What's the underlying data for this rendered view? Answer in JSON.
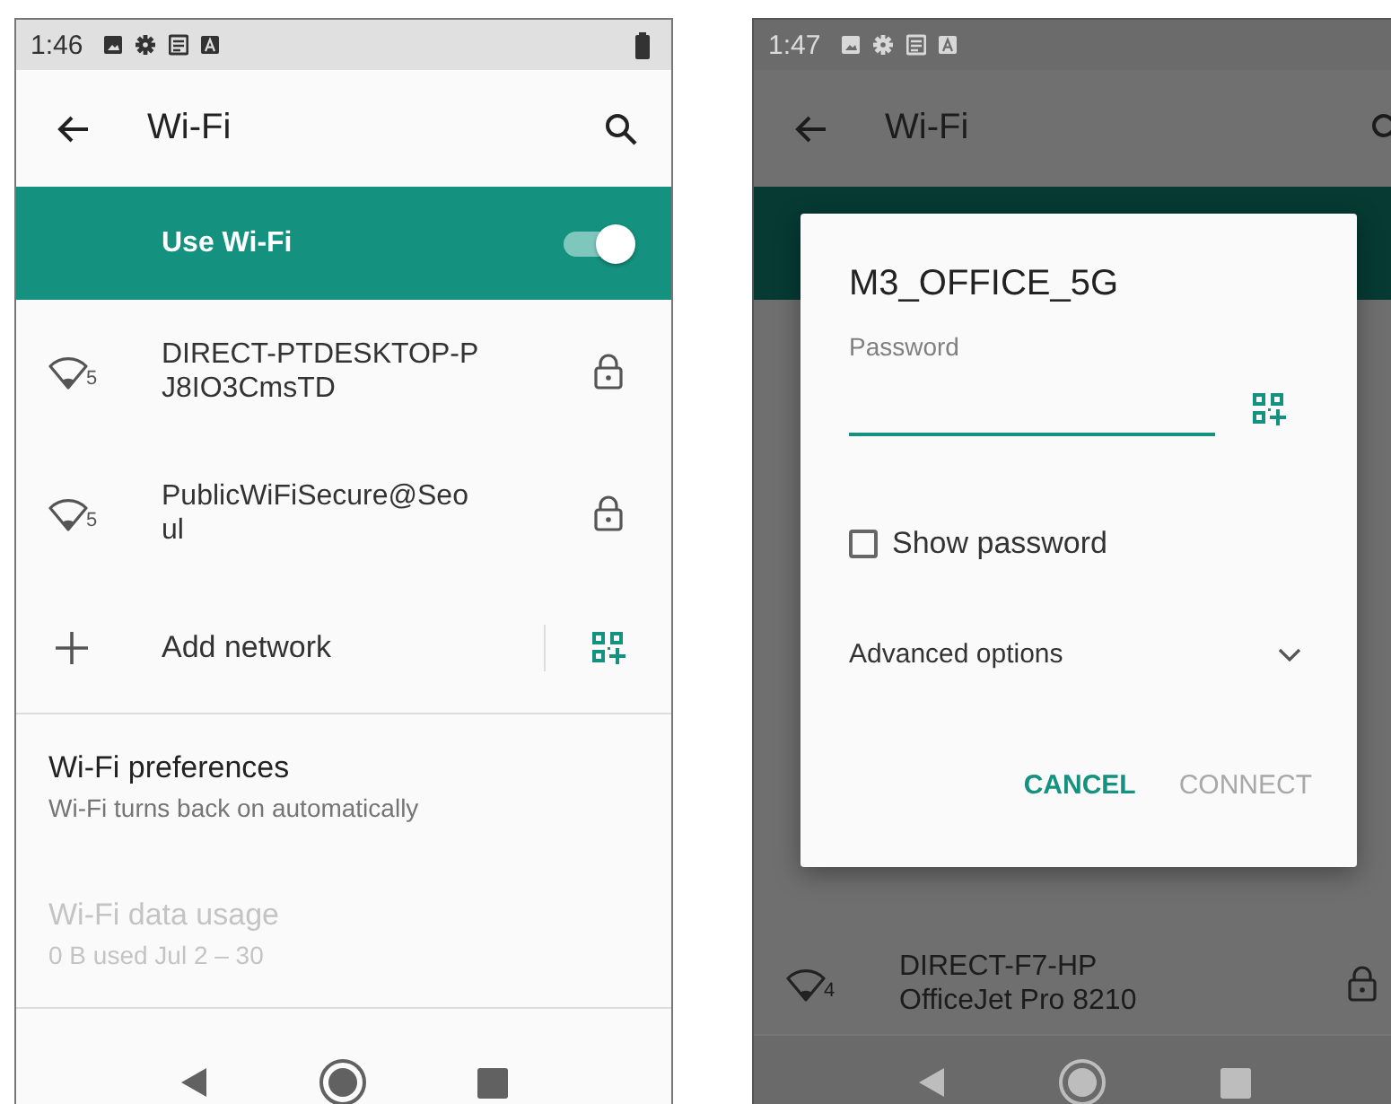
{
  "settings_screen": {
    "status_bar": {
      "time": "1:46"
    },
    "app_bar": {
      "title": "Wi-Fi"
    },
    "master_switch": {
      "label": "Use Wi-Fi",
      "on": true
    },
    "networks": [
      {
        "name_lines": [
          "DIRECT-PTDESKTOP-P",
          "J8IO3CmsTD"
        ],
        "band": "5",
        "locked": true
      },
      {
        "name_lines": [
          "PublicWiFiSecure@Seo",
          "ul"
        ],
        "band": "5",
        "locked": true
      }
    ],
    "add_network": {
      "label": "Add network"
    },
    "preferences": [
      {
        "title": "Wi-Fi preferences",
        "subtitle": "Wi-Fi turns back on automatically",
        "disabled": false
      },
      {
        "title": "Wi-Fi data usage",
        "subtitle": "0 B used Jul 2 – 30",
        "disabled": true
      }
    ]
  },
  "dialog_screen": {
    "status_bar": {
      "time": "1:47"
    },
    "app_bar": {
      "title": "Wi-Fi"
    },
    "background_network": {
      "name_lines": [
        "DIRECT-F7-HP",
        "OfficeJet Pro 8210"
      ],
      "band": "4",
      "locked": true
    },
    "dialog": {
      "title": "M3_OFFICE_5G",
      "password_label": "Password",
      "show_password": {
        "label": "Show password",
        "checked": false
      },
      "advanced_options": {
        "label": "Advanced options",
        "expanded": false
      },
      "buttons": [
        {
          "label": "CANCEL",
          "disabled": false
        },
        {
          "label": "CONNECT",
          "disabled": true
        }
      ]
    }
  }
}
